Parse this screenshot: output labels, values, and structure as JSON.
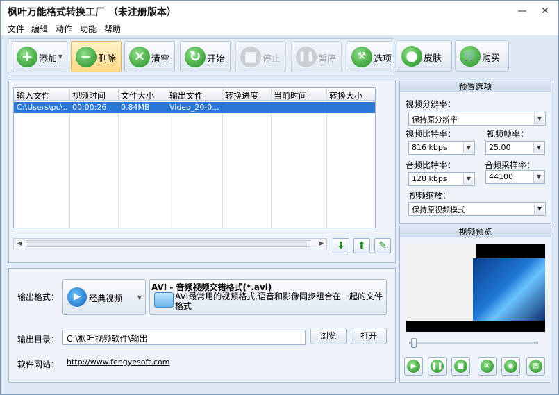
{
  "window": {
    "title": "枫叶万能格式转换工厂 （未注册版本）",
    "minimize": "—",
    "close": "✕"
  },
  "menu": [
    "文件",
    "编辑",
    "动作",
    "功能",
    "帮助"
  ],
  "toolbar": {
    "add": "添加",
    "delete": "删除",
    "clear": "清空",
    "start": "开始",
    "stop": "停止",
    "pause": "暂停",
    "options": "选项",
    "skin": "皮肤",
    "buy": "购买"
  },
  "file_table": {
    "columns": [
      "输入文件",
      "视频时间",
      "文件大小",
      "输出文件",
      "转换进度",
      "当前时间",
      "转换大小"
    ],
    "rows": [
      [
        "C:\\Users\\pc\\...",
        "00:00:26",
        "0.84MB",
        "Video_20-0...",
        "",
        "",
        ""
      ]
    ]
  },
  "output": {
    "format_label": "输出格式：",
    "format_category": "经典视频",
    "format_name": "AVI - 音频视频交错格式(*.avi)",
    "format_desc": "AVI最常用的视频格式,语音和影像同步组合在一起的文件格式",
    "dir_label": "输出目录：",
    "dir_value": "C:\\枫叶视频软件\\输出",
    "browse": "浏览",
    "open": "打开",
    "site_label": "软件网站：",
    "site_url": "http://www.fengyesoft.com"
  },
  "presets": {
    "title": "预置选项",
    "resolution_label": "视频分辨率：",
    "resolution_value": "保持原分辨率",
    "vbitrate_label": "视频比特率：",
    "vbitrate_value": "816 kbps",
    "framerate_label": "视频帧率：",
    "framerate_value": "25.00",
    "abitrate_label": "音频比特率：",
    "abitrate_value": "128 kbps",
    "samplerate_label": "音频采样率：",
    "samplerate_value": "44100",
    "scale_label": "视频缩放：",
    "scale_value": "保持原视频模式"
  },
  "preview": {
    "title": "视频预览",
    "progress": 0.0
  }
}
